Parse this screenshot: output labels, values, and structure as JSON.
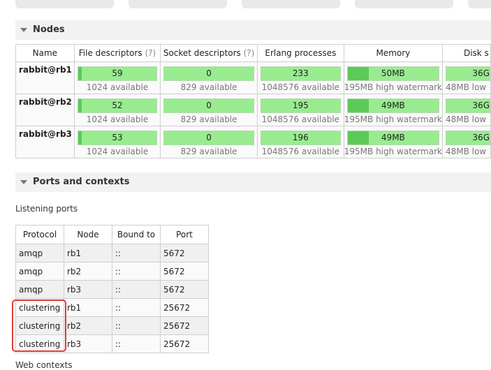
{
  "sections": {
    "nodes": "Nodes",
    "ports": "Ports and contexts"
  },
  "nodes_table": {
    "headers": {
      "name": "Name",
      "fd": "File descriptors",
      "sd": "Socket descriptors",
      "help": "(?)",
      "erlang": "Erlang processes",
      "memory": "Memory",
      "disk": "Disk s"
    },
    "rows": [
      {
        "name": "rabbit@rb1",
        "fd": "59",
        "fd_sub": "1024 available",
        "sd": "0",
        "sd_sub": "829 available",
        "erl": "233",
        "erl_sub": "1048576 available",
        "mem": "50MB",
        "mem_sub": "195MB high watermark",
        "disk": "36G",
        "disk_sub": "48MB low"
      },
      {
        "name": "rabbit@rb2",
        "fd": "52",
        "fd_sub": "1024 available",
        "sd": "0",
        "sd_sub": "829 available",
        "erl": "195",
        "erl_sub": "1048576 available",
        "mem": "49MB",
        "mem_sub": "195MB high watermark",
        "disk": "36G",
        "disk_sub": "48MB low"
      },
      {
        "name": "rabbit@rb3",
        "fd": "53",
        "fd_sub": "1024 available",
        "sd": "0",
        "sd_sub": "829 available",
        "erl": "196",
        "erl_sub": "1048576 available",
        "mem": "49MB",
        "mem_sub": "195MB high watermark",
        "disk": "36G",
        "disk_sub": "48MB low"
      }
    ]
  },
  "listening_ports": {
    "title": "Listening ports",
    "headers": {
      "protocol": "Protocol",
      "node": "Node",
      "bound": "Bound to",
      "port": "Port"
    },
    "rows": [
      {
        "protocol": "amqp",
        "node": "rb1",
        "bound": "::",
        "port": "5672"
      },
      {
        "protocol": "amqp",
        "node": "rb2",
        "bound": "::",
        "port": "5672"
      },
      {
        "protocol": "amqp",
        "node": "rb3",
        "bound": "::",
        "port": "5672"
      },
      {
        "protocol": "clustering",
        "node": "rb1",
        "bound": "::",
        "port": "25672"
      },
      {
        "protocol": "clustering",
        "node": "rb2",
        "bound": "::",
        "port": "25672"
      },
      {
        "protocol": "clustering",
        "node": "rb3",
        "bound": "::",
        "port": "25672"
      }
    ]
  },
  "web_contexts": {
    "title": "Web contexts"
  }
}
